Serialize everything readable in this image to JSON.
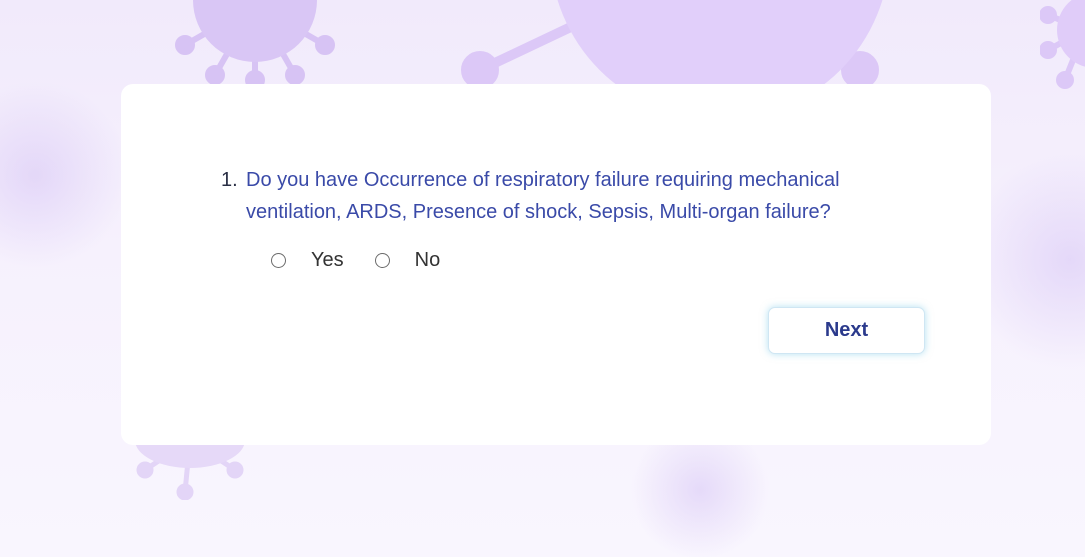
{
  "question": {
    "number": "1.",
    "text": "Do you have Occurrence of respiratory failure requiring mechanical ventilation, ARDS, Presence of shock, Sepsis, Multi-organ failure?"
  },
  "options": [
    {
      "label": "Yes",
      "selected": false
    },
    {
      "label": "No",
      "selected": false
    }
  ],
  "buttons": {
    "next_label": "Next"
  },
  "colors": {
    "question_text": "#3a4aa8",
    "button_text": "#2b3a8c",
    "background": "#f1eafb",
    "virus": "#d9c6f5"
  },
  "background_icons": [
    "virus-icon"
  ]
}
